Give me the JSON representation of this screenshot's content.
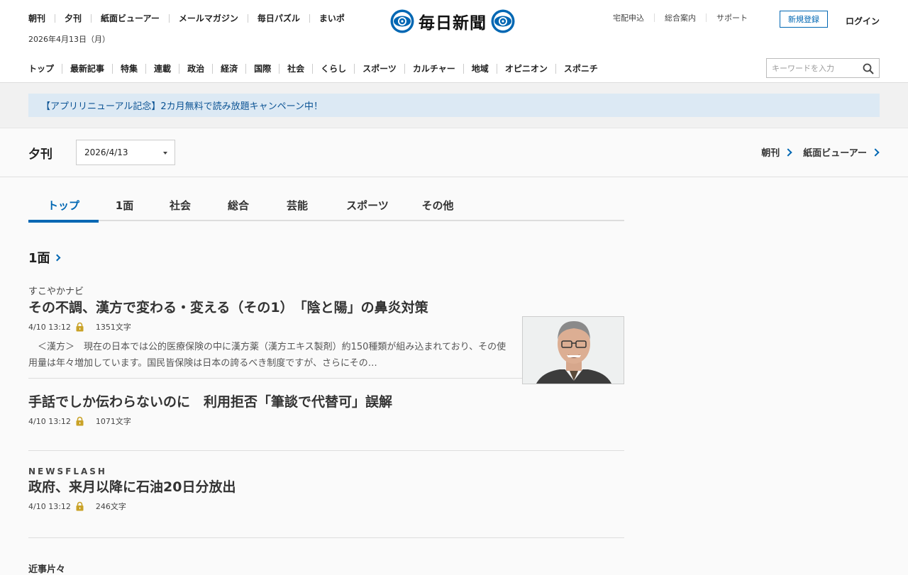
{
  "header": {
    "util_nav": [
      "朝刊",
      "夕刊",
      "紙面ビューアー",
      "メールマガジン",
      "毎日パズル",
      "まいポ"
    ],
    "date": "2026年4月13日（月）",
    "logo_text": "毎日新聞",
    "right_links": [
      "宅配申込",
      "総合案内",
      "サポート"
    ],
    "register_label": "新規登録",
    "login_label": "ログイン",
    "main_nav": [
      "トップ",
      "最新記事",
      "特集",
      "連載",
      "政治",
      "経済",
      "国際",
      "社会",
      "くらし",
      "スポーツ",
      "カルチャー",
      "地域",
      "オピニオン",
      "スポニチ"
    ],
    "search_placeholder": "キーワードを入力"
  },
  "banner": {
    "text": "【アプリリニューアル記念】2カ月無料で読み放題キャンペーン中！"
  },
  "edition": {
    "title": "夕刊",
    "date_value": "2026/4/13",
    "links": [
      "朝刊",
      "紙面ビューアー"
    ]
  },
  "tabs": [
    "トップ",
    "1面",
    "社会",
    "総合",
    "芸能",
    "スポーツ",
    "その他"
  ],
  "active_tab": "トップ",
  "section": {
    "title": "1面"
  },
  "articles": [
    {
      "kicker": "すこやかナビ",
      "headline": "その不調、漢方で変わる・変える（その1）　「陰と陽」の鼻炎対策",
      "time": "4/10 13:12",
      "length": "1351文字",
      "excerpt": "　＜漢方＞　現在の日本では公的医療保険の中に漢方薬（漢方エキス製剤）約150種類が組み込まれており、その使用量は年々増加しています。国民皆保険は日本の誇るべき制度ですが、さらにその…"
    },
    {
      "headline": "手話でしか伝わらないのに　利用拒否「筆談で代替可」誤解",
      "time": "4/10 13:12",
      "length": "1071文字"
    },
    {
      "kicker": "NEWSFLASH",
      "headline": "政府、来月以降に石油20日分放出",
      "time": "4/10 13:12",
      "length": "246文字"
    }
  ],
  "next_section": {
    "title": "近事片々"
  },
  "colors": {
    "accent": "#0067b3",
    "banner_bg": "#dce9f4",
    "lock": "#c9a227"
  }
}
